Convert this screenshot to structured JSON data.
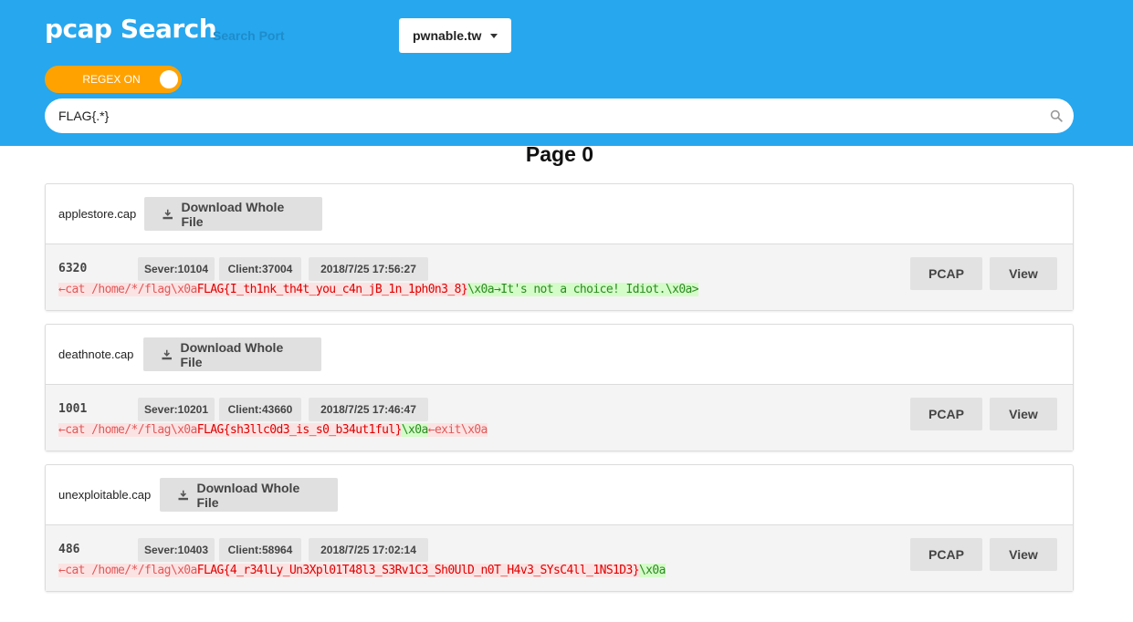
{
  "app": {
    "title": "pcap Search"
  },
  "port": {
    "placeholder": "Search Port"
  },
  "host": {
    "selected": "pwnable.tw"
  },
  "regex_toggle": {
    "label": "REGEX ON"
  },
  "search": {
    "value": "FLAG{.*}"
  },
  "page": {
    "title": "Page 0"
  },
  "labels": {
    "download": "Download Whole File",
    "pcap": "PCAP",
    "view": "View"
  },
  "results": [
    {
      "file": "applestore.cap",
      "id": "6320",
      "server": "Sever:10104",
      "client": "Client:37004",
      "time": "2018/7/25 17:56:27",
      "pre": "←cat /home/*/flag\\x0a",
      "match": "FLAG{I_th1nk_th4t_you_c4n_jB_1n_1ph0n3_8}",
      "post": "\\x0a→It's not a choice! Idiot.\\x0a>",
      "post_extra": ""
    },
    {
      "file": "deathnote.cap",
      "id": "1001",
      "server": "Sever:10201",
      "client": "Client:43660",
      "time": "2018/7/25 17:46:47",
      "pre": "←cat /home/*/flag\\x0a",
      "match": "FLAG{sh3llc0d3_is_s0_b34ut1ful}",
      "post": "\\x0a",
      "post_extra": "←exit\\x0a"
    },
    {
      "file": "unexploitable.cap",
      "id": "486",
      "server": "Sever:10403",
      "client": "Client:58964",
      "time": "2018/7/25 17:02:14",
      "pre": "←cat /home/*/flag\\x0a",
      "match": "FLAG{4_r34lLy_Un3Xpl01T48l3_S3Rv1C3_Sh0UlD_n0T_H4v3_SYsC4ll_1NS1D3}",
      "post": "\\x0a",
      "post_extra": ""
    }
  ]
}
